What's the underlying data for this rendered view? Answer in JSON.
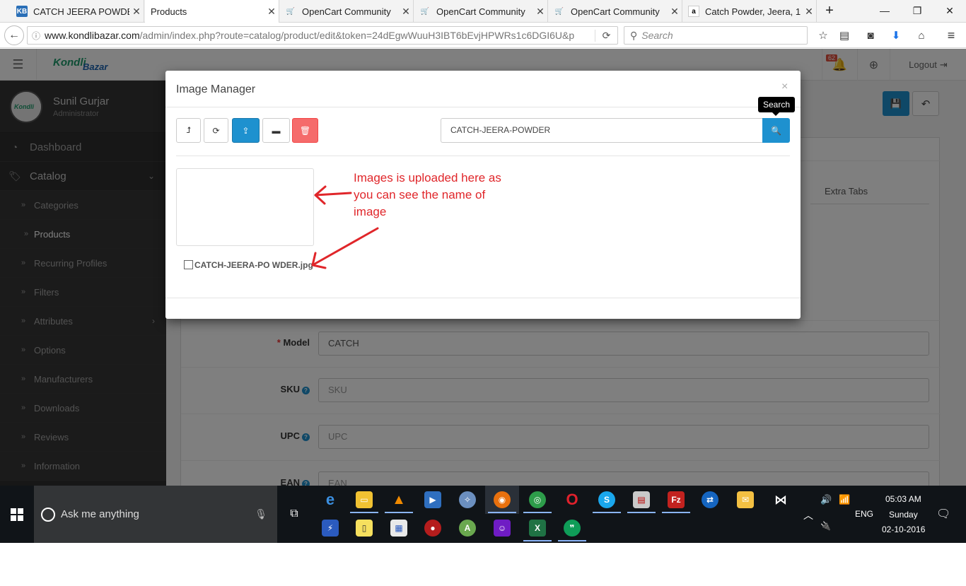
{
  "browser": {
    "tabs": [
      {
        "title": "CATCH JEERA POWDE",
        "favicon": "KB",
        "active": false
      },
      {
        "title": "Products",
        "favicon": "",
        "active": true
      },
      {
        "title": "OpenCart Community",
        "favicon": "oc",
        "active": false
      },
      {
        "title": "OpenCart Community",
        "favicon": "oc",
        "active": false
      },
      {
        "title": "OpenCart Community",
        "favicon": "oc",
        "active": false
      },
      {
        "title": "Catch Powder, Jeera, 1",
        "favicon": "a",
        "active": false
      }
    ],
    "url_domain": "www.kondlibazar.com",
    "url_path": "/admin/index.php?route=catalog/product/edit&token=24dEgwWuuH3IBT6bEvjHPWRs1c6DGI6U&p",
    "search_placeholder": "Search"
  },
  "app": {
    "logo_text": "KondliBazar",
    "header": {
      "notification_count": "62",
      "logout_label": "Logout"
    },
    "user": {
      "name": "Sunil Gurjar",
      "role": "Administrator"
    },
    "sidebar": {
      "top_items": [
        {
          "label": "Dashboard",
          "icon": "dashboard-icon"
        },
        {
          "label": "Catalog",
          "icon": "tags-icon"
        }
      ],
      "catalog_items": [
        {
          "label": "Categories",
          "active": false,
          "has_children": false
        },
        {
          "label": "Products",
          "active": true,
          "has_children": false
        },
        {
          "label": "Recurring Profiles",
          "active": false,
          "has_children": false
        },
        {
          "label": "Filters",
          "active": false,
          "has_children": false
        },
        {
          "label": "Attributes",
          "active": false,
          "has_children": true
        },
        {
          "label": "Options",
          "active": false,
          "has_children": false
        },
        {
          "label": "Manufacturers",
          "active": false,
          "has_children": false
        },
        {
          "label": "Downloads",
          "active": false,
          "has_children": false
        },
        {
          "label": "Reviews",
          "active": false,
          "has_children": false
        },
        {
          "label": "Information",
          "active": false,
          "has_children": false
        }
      ]
    },
    "form": {
      "extra_tab_label": "Extra Tabs",
      "fields": [
        {
          "label": "Model",
          "required": true,
          "help": false,
          "value": "CATCH",
          "placeholder": "Model"
        },
        {
          "label": "SKU",
          "required": false,
          "help": true,
          "value": "",
          "placeholder": "SKU"
        },
        {
          "label": "UPC",
          "required": false,
          "help": true,
          "value": "",
          "placeholder": "UPC"
        },
        {
          "label": "EAN",
          "required": false,
          "help": true,
          "value": "",
          "placeholder": "EAN"
        }
      ]
    }
  },
  "modal": {
    "title": "Image Manager",
    "close_glyph": "×",
    "search_value": "CATCH-JEERA-POWDER",
    "search_tooltip": "Search",
    "file_name": "CATCH-JEERA-PO WDER.jpg",
    "annotation": "Images is uploaded here as you can see the name of image",
    "annotation_color": "#e0262a"
  },
  "taskbar": {
    "cortana_placeholder": "Ask me anything",
    "language": "ENG",
    "time": "05:03 AM",
    "day": "Sunday",
    "date": "02-10-2016"
  },
  "colors": {
    "primary": "#1e91cf",
    "danger": "#f56b6b",
    "sidebar_bg": "#2f2f2f"
  }
}
